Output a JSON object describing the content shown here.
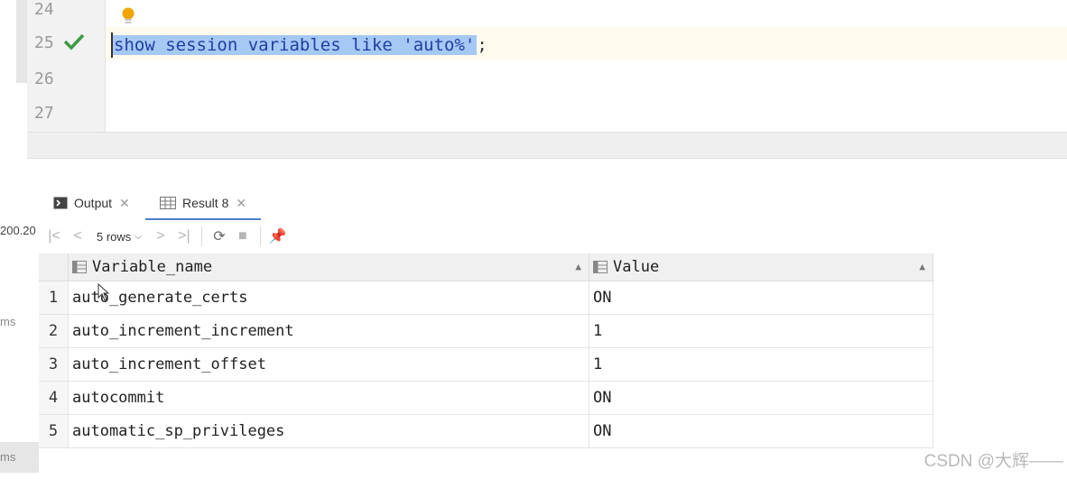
{
  "editor": {
    "line_numbers": [
      "24",
      "25",
      "26",
      "27"
    ],
    "query": "show session variables like 'auto%'",
    "terminator": ";"
  },
  "left_edge": [
    "200.20",
    "ms",
    "ms"
  ],
  "tabs": [
    {
      "label": "Output",
      "icon": "console-icon"
    },
    {
      "label": "Result 8",
      "icon": "table-icon"
    }
  ],
  "toolbar": {
    "rows_label": "5 rows"
  },
  "table": {
    "columns": [
      "Variable_name",
      "Value"
    ],
    "rows": [
      {
        "num": "1",
        "name": "auto_generate_certs",
        "value": "ON"
      },
      {
        "num": "2",
        "name": "auto_increment_increment",
        "value": "1"
      },
      {
        "num": "3",
        "name": "auto_increment_offset",
        "value": "1"
      },
      {
        "num": "4",
        "name": "autocommit",
        "value": "ON"
      },
      {
        "num": "5",
        "name": "automatic_sp_privileges",
        "value": "ON"
      }
    ]
  },
  "watermark": "CSDN @大辉——",
  "colors": {
    "selection": "#a6c8f5",
    "keyword": "#1f3fa0",
    "accent": "#4d7ecb",
    "check": "#3c9a45",
    "bulb": "#f0a500"
  }
}
